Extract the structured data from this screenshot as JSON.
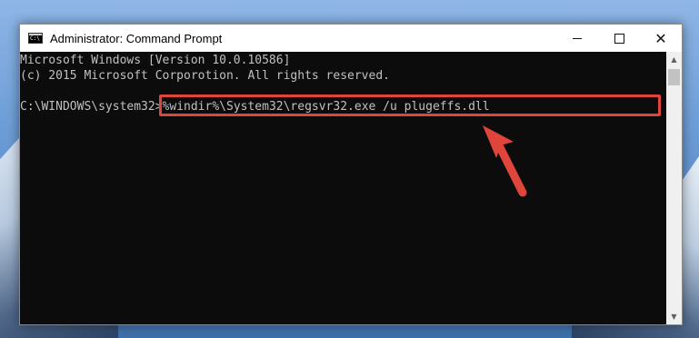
{
  "window": {
    "title": "Administrator: Command Prompt",
    "minimize_icon": "minimize-icon",
    "maximize_icon": "maximize-icon",
    "close_glyph": "✕"
  },
  "console": {
    "lines": [
      "Microsoft Windows [Version 10.0.10586]",
      "(c) 2015 Microsoft Corporotion. All rights reserved.",
      "",
      "C:\\WINDOWS\\system32>%windir%\\System32\\regsvr32.exe /u plugeffs.dll"
    ],
    "prompt": "C:\\WINDOWS\\system32>",
    "command": "%windir%\\System32\\regsvr32.exe /u plugeffs.dll"
  },
  "scrollbar": {
    "up_glyph": "▲",
    "down_glyph": "▼"
  },
  "annotation": {
    "highlight_color": "#e0453c",
    "arrow_color": "#e0453c"
  },
  "colors": {
    "console_bg": "#0c0c0c",
    "console_text": "#c0c0c0"
  }
}
